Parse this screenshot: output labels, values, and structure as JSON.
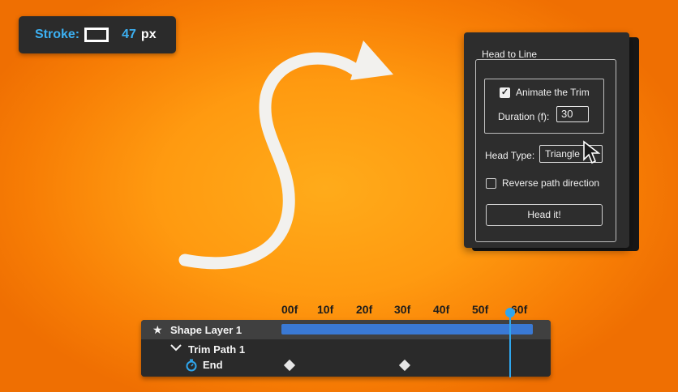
{
  "stroke": {
    "label": "Stroke:",
    "value": "47",
    "unit": "px"
  },
  "panel": {
    "title": "Head to Line",
    "animate_trim": {
      "label": "Animate the Trim",
      "checked": true
    },
    "duration": {
      "label": "Duration (f):",
      "value": "30"
    },
    "head_type": {
      "label": "Head Type:",
      "value": "Triangle"
    },
    "reverse": {
      "label": "Reverse path direction",
      "checked": false
    },
    "button_label": "Head it!"
  },
  "timeline": {
    "ticks": [
      "00f",
      "10f",
      "20f",
      "30f",
      "40f",
      "50f",
      "60f"
    ],
    "layer_name": "Shape Layer 1",
    "trim_path": "Trim Path 1",
    "property": "End",
    "keyframes_frames": [
      0,
      30
    ],
    "playhead_frame": 60,
    "accent_color": "#2fa6ee",
    "bar_color": "#3a79d4"
  },
  "icons": {
    "stroke_swatch": "stroke-swatch-icon",
    "layer": "star-icon",
    "expand": "chevron-down-icon",
    "property": "stopwatch-icon",
    "cursor": "mouse-pointer-icon"
  }
}
